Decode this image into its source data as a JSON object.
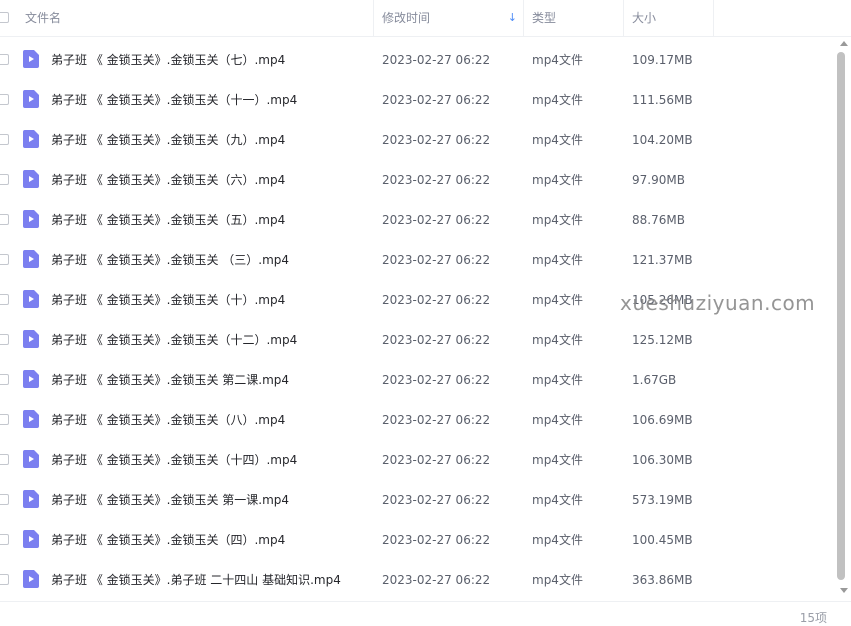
{
  "header": {
    "col_name": "文件名",
    "col_time": "修改时间",
    "col_type": "类型",
    "col_size": "大小",
    "sort_icon": "arrow-down-icon"
  },
  "files": [
    {
      "name": "弟子班 《 金锁玉关》.金锁玉关（七）.mp4",
      "time": "2023-02-27 06:22",
      "type": "mp4文件",
      "size": "109.17MB"
    },
    {
      "name": "弟子班 《 金锁玉关》.金锁玉关（十一）.mp4",
      "time": "2023-02-27 06:22",
      "type": "mp4文件",
      "size": "111.56MB"
    },
    {
      "name": "弟子班 《 金锁玉关》.金锁玉关（九）.mp4",
      "time": "2023-02-27 06:22",
      "type": "mp4文件",
      "size": "104.20MB"
    },
    {
      "name": "弟子班 《 金锁玉关》.金锁玉关（六）.mp4",
      "time": "2023-02-27 06:22",
      "type": "mp4文件",
      "size": "97.90MB"
    },
    {
      "name": "弟子班 《 金锁玉关》.金锁玉关（五）.mp4",
      "time": "2023-02-27 06:22",
      "type": "mp4文件",
      "size": "88.76MB"
    },
    {
      "name": "弟子班 《 金锁玉关》.金锁玉关 （三）.mp4",
      "time": "2023-02-27 06:22",
      "type": "mp4文件",
      "size": "121.37MB"
    },
    {
      "name": "弟子班 《 金锁玉关》.金锁玉关（十）.mp4",
      "time": "2023-02-27 06:22",
      "type": "mp4文件",
      "size": "105.26MB"
    },
    {
      "name": "弟子班 《 金锁玉关》.金锁玉关（十二）.mp4",
      "time": "2023-02-27 06:22",
      "type": "mp4文件",
      "size": "125.12MB"
    },
    {
      "name": "弟子班 《 金锁玉关》.金锁玉关  第二课.mp4",
      "time": "2023-02-27 06:22",
      "type": "mp4文件",
      "size": "1.67GB"
    },
    {
      "name": "弟子班 《 金锁玉关》.金锁玉关（八）.mp4",
      "time": "2023-02-27 06:22",
      "type": "mp4文件",
      "size": "106.69MB"
    },
    {
      "name": "弟子班 《 金锁玉关》.金锁玉关（十四）.mp4",
      "time": "2023-02-27 06:22",
      "type": "mp4文件",
      "size": "106.30MB"
    },
    {
      "name": "弟子班 《 金锁玉关》.金锁玉关  第一课.mp4",
      "time": "2023-02-27 06:22",
      "type": "mp4文件",
      "size": "573.19MB"
    },
    {
      "name": "弟子班 《 金锁玉关》.金锁玉关（四）.mp4",
      "time": "2023-02-27 06:22",
      "type": "mp4文件",
      "size": "100.45MB"
    },
    {
      "name": "弟子班 《 金锁玉关》.弟子班  二十四山 基础知识.mp4",
      "time": "2023-02-27 06:22",
      "type": "mp4文件",
      "size": "363.86MB"
    }
  ],
  "footer": {
    "count": "15项"
  },
  "watermark": "xueshuziyuan.com",
  "colors": {
    "icon": "#7b7ff0",
    "sort_arrow": "#4e8cf7"
  }
}
